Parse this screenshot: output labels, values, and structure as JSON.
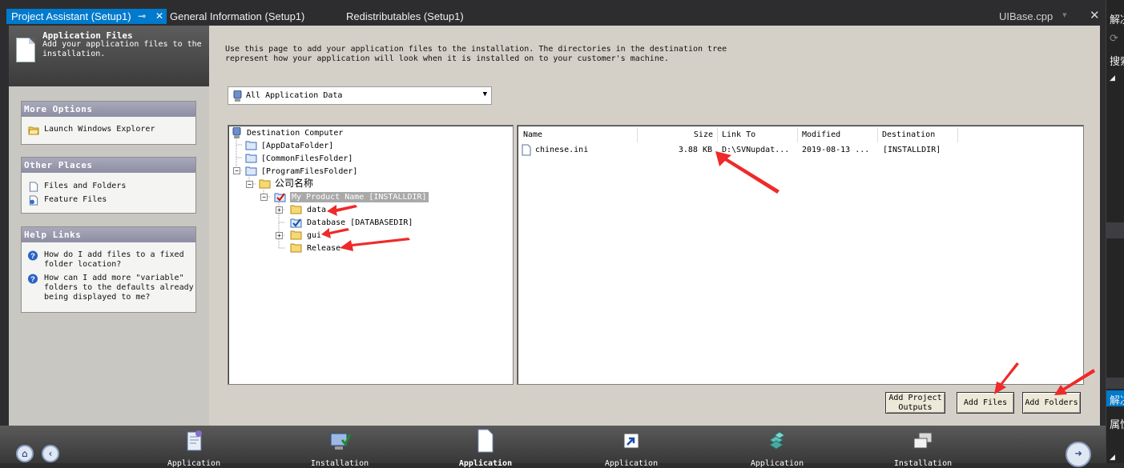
{
  "tabs": {
    "project_assistant": "Project Assistant (Setup1)",
    "general_information": "General Information (Setup1)",
    "redistributables": "Redistributables (Setup1)",
    "uibase": "UIBase.cpp"
  },
  "right_panel": {
    "top_label": "解决",
    "search_label": "搜索",
    "bottom_blue_label": "解决",
    "bottom_label": "属性"
  },
  "header": {
    "title": "Application Files",
    "subtitle": "Add your application files to the installation."
  },
  "more_options": {
    "title": "More Options",
    "items": [
      "Launch Windows Explorer"
    ]
  },
  "other_places": {
    "title": "Other Places",
    "items": [
      "Files and Folders",
      "Feature Files"
    ]
  },
  "help_links": {
    "title": "Help Links",
    "items": [
      "How do I add files to a fixed folder location?",
      "How can I add more \"variable\" folders to the defaults already being displayed to me?"
    ]
  },
  "intro_text": "Use this page to add your application files to the installation. The directories in the destination tree\nrepresent how your application will look when it is installed on to your customer's machine.",
  "filter_dropdown": {
    "selected": "All Application Data"
  },
  "tree": {
    "root": "Destination Computer",
    "app_data_folder": "[AppDataFolder]",
    "common_files_folder": "[CommonFilesFolder]",
    "program_files_folder": "[ProgramFilesFolder]",
    "company_folder": "公司名称",
    "product_folder": "My Product Name [INSTALLDIR]",
    "data_folder": "data",
    "database_folder": "Database [DATABASEDIR]",
    "gui_folder": "gui",
    "release_folder": "Release"
  },
  "file_list": {
    "columns": [
      "Name",
      "Size",
      "Link To",
      "Modified",
      "Destination"
    ],
    "rows": [
      {
        "name": "chinese.ini",
        "size": "3.88 KB",
        "link_to": "D:\\SVNupdat...",
        "modified": "2019-08-13 ...",
        "destination": "[INSTALLDIR]"
      }
    ]
  },
  "buttons": {
    "add_project_outputs": "Add Project Outputs",
    "add_files": "Add Files",
    "add_folders": "Add Folders"
  },
  "nav": {
    "items": [
      "Application",
      "Installation",
      "Application",
      "Application",
      "Application",
      "Installation"
    ],
    "current_index": 2
  },
  "colors": {
    "accent_blue": "#007acc",
    "annotation_red": "#ee2a2a",
    "tree_selection": "#a9a9a9"
  }
}
